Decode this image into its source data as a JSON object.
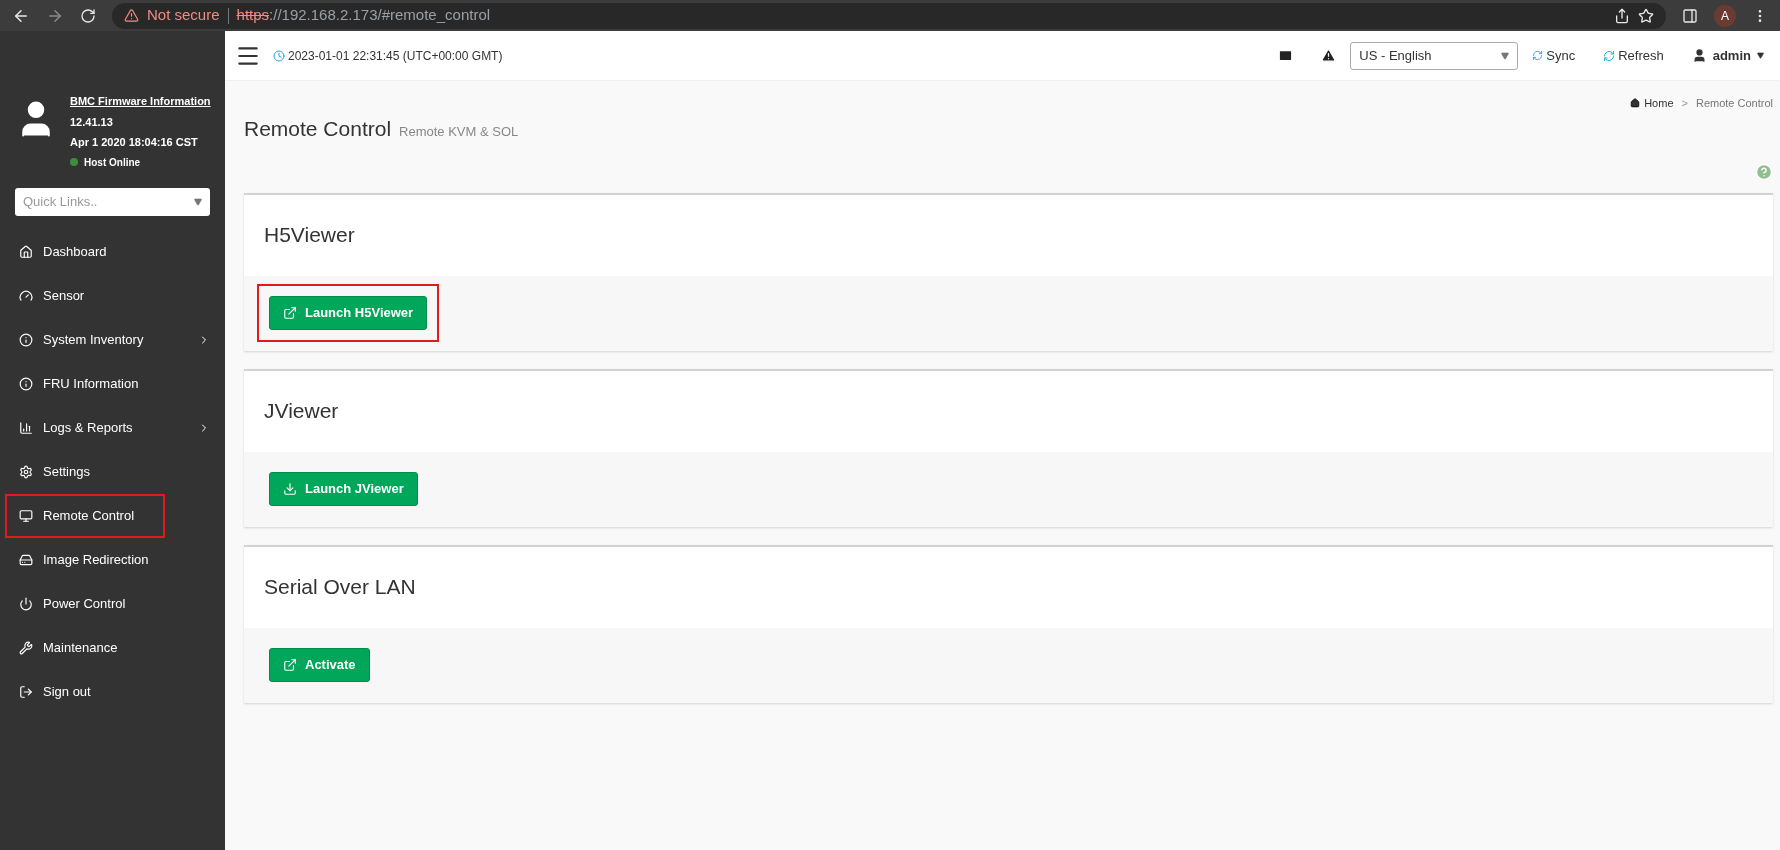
{
  "browser": {
    "security": "Not secure",
    "url_scheme": "https",
    "url_rest": "://192.168.2.173/#remote_control",
    "profile_initial": "A"
  },
  "header": {
    "datetime": "2023-01-01 22:31:45 (UTC+00:00 GMT)",
    "language": "US - English",
    "sync": "Sync",
    "refresh": "Refresh",
    "user": "admin"
  },
  "sidebar": {
    "firmware_link": "BMC Firmware Information",
    "version": "12.41.13",
    "build_date": "Apr 1 2020 18:04:16 CST",
    "host_status": "Host Online",
    "quick_links_placeholder": "Quick Links..",
    "items": [
      {
        "label": "Dashboard",
        "submenu": false,
        "highlighted": false
      },
      {
        "label": "Sensor",
        "submenu": false,
        "highlighted": false
      },
      {
        "label": "System Inventory",
        "submenu": true,
        "highlighted": false
      },
      {
        "label": "FRU Information",
        "submenu": false,
        "highlighted": false
      },
      {
        "label": "Logs & Reports",
        "submenu": true,
        "highlighted": false
      },
      {
        "label": "Settings",
        "submenu": false,
        "highlighted": false
      },
      {
        "label": "Remote Control",
        "submenu": false,
        "highlighted": true
      },
      {
        "label": "Image Redirection",
        "submenu": false,
        "highlighted": false
      },
      {
        "label": "Power Control",
        "submenu": false,
        "highlighted": false
      },
      {
        "label": "Maintenance",
        "submenu": false,
        "highlighted": false
      },
      {
        "label": "Sign out",
        "submenu": false,
        "highlighted": false
      }
    ]
  },
  "page": {
    "title": "Remote Control",
    "subtitle": "Remote KVM & SOL",
    "breadcrumb": [
      "Home",
      "Remote Control"
    ],
    "breadcrumb_separator": ">"
  },
  "cards": [
    {
      "title": "H5Viewer",
      "button": "Launch H5Viewer",
      "highlighted": true
    },
    {
      "title": "JViewer",
      "button": "Launch JViewer",
      "highlighted": false
    },
    {
      "title": "Serial Over LAN",
      "button": "Activate",
      "highlighted": false
    }
  ]
}
